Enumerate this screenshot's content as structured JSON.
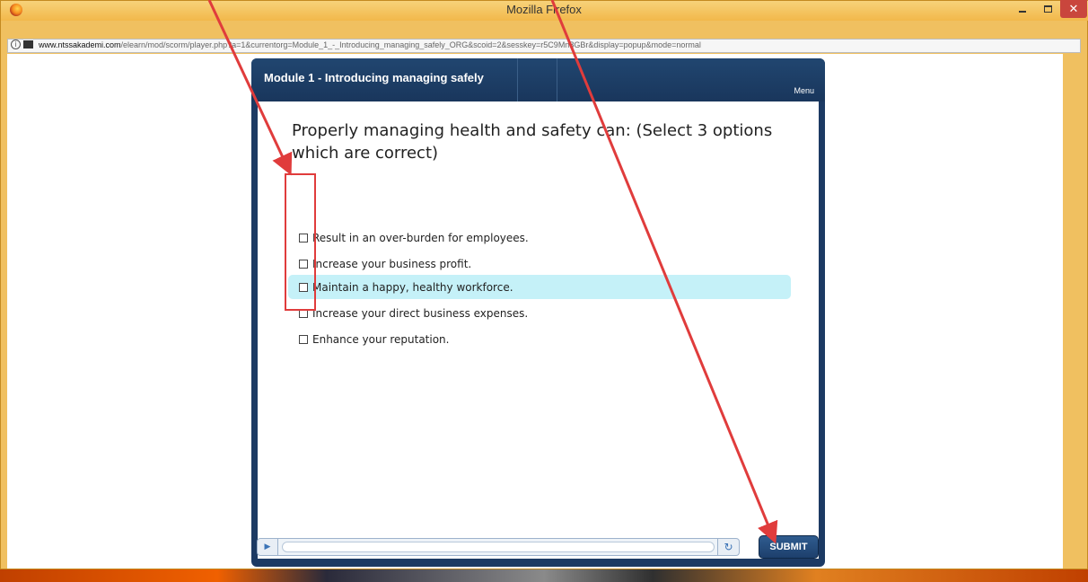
{
  "window": {
    "title": "Mozilla Firefox",
    "minimize_icon": "minimize-icon",
    "maximize_icon": "maximize-icon",
    "close_icon": "close-icon",
    "close_glyph": "✕"
  },
  "addressbar": {
    "info_icon_glyph": "i",
    "url_domain": "www.ntssakademi.com",
    "url_rest": "/elearn/mod/scorm/player.php?a=1&currentorg=Module_1_-_Introducing_managing_safely_ORG&scoid=2&sesskey=r5C9Mn8GBr&display=popup&mode=normal"
  },
  "player": {
    "module_title": "Module 1 - Introducing managing safely",
    "menu_label": "Menu",
    "question": "Properly managing health and safety can: (Select 3 options which are correct)",
    "options": [
      {
        "label": "Result in an over-burden for employees.",
        "checked": false,
        "highlighted": false
      },
      {
        "label": "Increase your business profit.",
        "checked": false,
        "highlighted": false
      },
      {
        "label": "Maintain a happy, healthy workforce.",
        "checked": false,
        "highlighted": true
      },
      {
        "label": "Increase your direct business expenses.",
        "checked": false,
        "highlighted": false
      },
      {
        "label": "Enhance your reputation.",
        "checked": false,
        "highlighted": false
      }
    ],
    "play_glyph": "▶",
    "reload_glyph": "↻",
    "submit_label": "SUBMIT",
    "progress": 0
  },
  "colors": {
    "player_bg": "#1c3a63",
    "highlight": "#c5f1f8",
    "annotation_red": "#e03c3c"
  }
}
